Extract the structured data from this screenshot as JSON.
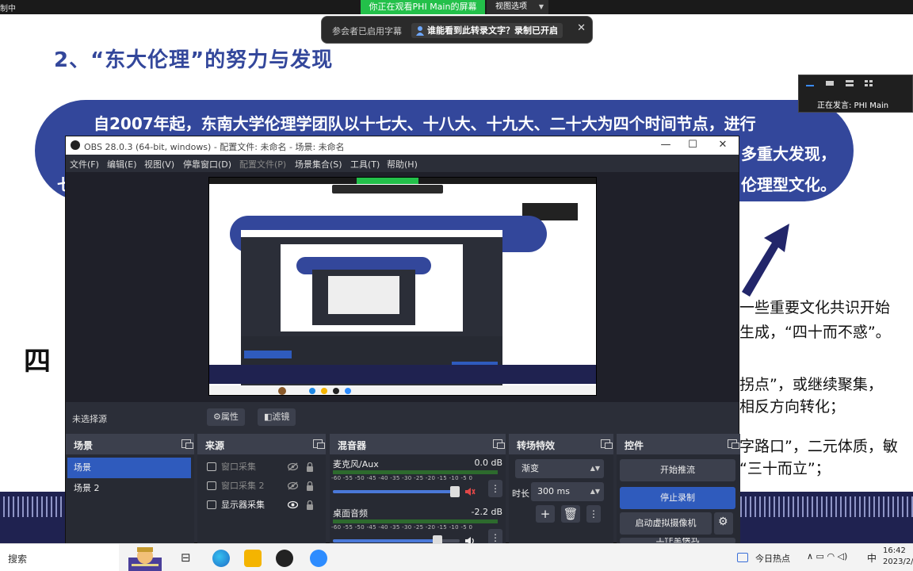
{
  "zoom": {
    "recording_status": "制中",
    "viewing_badge": "你正在观看PHI Main的屏幕",
    "view_options": "视图选项",
    "caption_notice": "参会者已启用字幕",
    "caption_question": "谁能看到此转录文字？录制已开启",
    "speaker_label": "正在发言: PHI Main"
  },
  "slide": {
    "title": "2、“东大伦理”的努力与发现",
    "line1": "自2007年起，东南大学伦理学团队以十七大、十八大、十九大、二十大为四个时间节点，进行",
    "line2_right": "多重大发现，",
    "line3_left": "七",
    "line3_right": "伦理型文化。",
    "para1a": "一些重要文化共识开始",
    "para1b": "生成，“四十而不惑”。",
    "para2a": "拐点”，或继续聚集，",
    "para2b": "相反方向转化；",
    "para3a": "字路口”，二元体质，敏",
    "para3b": "“三十而立”；",
    "scribble": "四"
  },
  "obs": {
    "title": "OBS 28.0.3 (64-bit, windows) - 配置文件: 未命名 - 场景: 未命名",
    "menu": [
      "文件(F)",
      "编辑(E)",
      "视图(V)",
      "停靠窗口(D)",
      "配置文件(P)",
      "场景集合(S)",
      "工具(T)",
      "帮助(H)"
    ],
    "no_source": "未选择源",
    "properties_btn": "属性",
    "filters_btn": "滤镜",
    "docks": {
      "scenes": "场景",
      "sources": "来源",
      "mixer": "混音器",
      "transitions": "转场特效",
      "controls": "控件"
    },
    "scenes": [
      "场景",
      "场景 2"
    ],
    "sources": [
      {
        "name": "窗口采集",
        "visible": false
      },
      {
        "name": "窗口采集 2",
        "visible": false
      },
      {
        "name": "显示器采集",
        "visible": true
      }
    ],
    "mixer": [
      {
        "name": "麦克风/Aux",
        "db": "0.0 dB",
        "volume": 1.0
      },
      {
        "name": "桌面音频",
        "db": "-2.2 dB",
        "volume": 0.85
      }
    ],
    "meter_scale": "-60 -55 -50 -45 -40 -35 -30 -25 -20 -15 -10 -5 0",
    "transition": {
      "type": "渐变",
      "duration_label": "时长",
      "duration": "300 ms"
    },
    "controls": {
      "start_stream": "开始推流",
      "stop_record": "停止录制",
      "virtual_cam": "启动虚拟摄像机",
      "studio_mode": "工作室模式"
    }
  },
  "taskbar": {
    "search": "搜索",
    "news": "今日热点",
    "ime": "中",
    "time": "16:42",
    "date": "2023/2/"
  },
  "colors": {
    "slide_blue": "#33479b",
    "obs_bg": "#2b2e38",
    "obs_accent": "#2f5bbd",
    "zoom_green": "#23c04a"
  }
}
